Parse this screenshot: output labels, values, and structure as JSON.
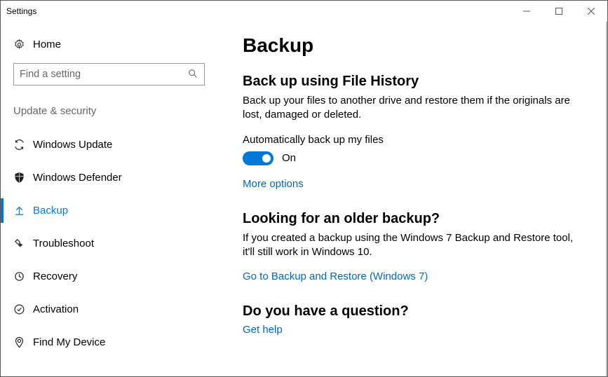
{
  "window": {
    "title": "Settings"
  },
  "sidebar": {
    "home_label": "Home",
    "search_placeholder": "Find a setting",
    "section_label": "Update & security",
    "items": [
      {
        "label": "Windows Update"
      },
      {
        "label": "Windows Defender"
      },
      {
        "label": "Backup"
      },
      {
        "label": "Troubleshoot"
      },
      {
        "label": "Recovery"
      },
      {
        "label": "Activation"
      },
      {
        "label": "Find My Device"
      }
    ]
  },
  "main": {
    "page_title": "Backup",
    "file_history": {
      "heading": "Back up using File History",
      "desc": "Back up your files to another drive and restore them if the originals are lost, damaged or deleted.",
      "toggle_label": "Automatically back up my files",
      "toggle_state": "On",
      "more_options": "More options"
    },
    "older_backup": {
      "heading": "Looking for an older backup?",
      "desc": "If you created a backup using the Windows 7 Backup and Restore tool, it'll still work in Windows 10.",
      "link": "Go to Backup and Restore (Windows 7)"
    },
    "question": {
      "heading": "Do you have a question?",
      "link": "Get help"
    }
  }
}
